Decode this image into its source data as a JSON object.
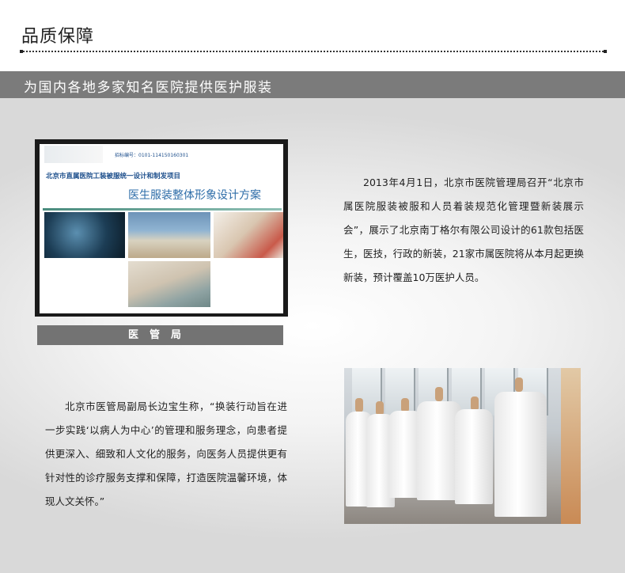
{
  "header": {
    "title": "品质保障"
  },
  "banner": {
    "text": "为国内各地多家知名医院提供医护服装"
  },
  "cover_image": {
    "code_text": "招标编号：0101-114150160301",
    "subtitle": "北京市直属医院工装被服统一设计和制发项目",
    "main_title": "医生服装整体形象设计方案",
    "caption": "医管局"
  },
  "paragraphs": {
    "p1": "2013年4月1日，北京市医院管理局召开“北京市属医院服装被服和人员着装规范化管理暨新装展示会”，展示了北京南丁格尔有限公司设计的61款包括医生，医技，行政的新装，21家市属医院将从本月起更换新装，预计覆盖10万医护人员。",
    "p2": "北京市医管局副局长边宝生称，“换装行动旨在进一步实践‘以病人为中心’的管理和服务理念，向患者提供更深入、细致和人文化的服务，向医务人员提供更有针对性的诊疗服务支撑和保障，打造医院温馨环境，体现人文关怀。”"
  }
}
